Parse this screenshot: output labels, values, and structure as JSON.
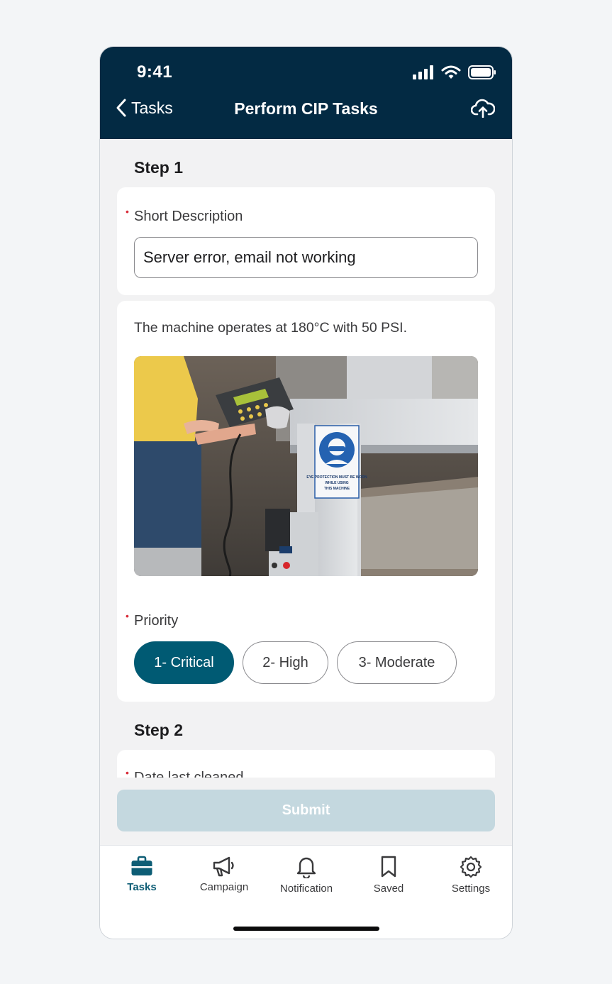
{
  "status": {
    "time": "9:41"
  },
  "nav": {
    "back_label": "Tasks",
    "title": "Perform CIP Tasks"
  },
  "step1": {
    "heading": "Step 1",
    "short_description_label": "Short Description",
    "short_description_value": "Server error, email not working",
    "description_text": "The machine operates at 180°C with 50 PSI.",
    "image_sign_text": "EYE PROTECTION MUST BE WORN WHILE USING THIS MACHINE",
    "priority_label": "Priority",
    "priority_options": [
      "1- Critical",
      "2- High",
      "3- Moderate"
    ],
    "priority_selected": "1- Critical"
  },
  "step2": {
    "heading": "Step 2",
    "date_label": "Date last cleaned"
  },
  "submit_label": "Submit",
  "tabs": [
    {
      "label": "Tasks",
      "icon": "briefcase-icon",
      "active": true
    },
    {
      "label": "Campaign",
      "icon": "megaphone-icon",
      "active": false
    },
    {
      "label": "Notification",
      "icon": "bell-icon",
      "active": false
    },
    {
      "label": "Saved",
      "icon": "bookmark-icon",
      "active": false
    },
    {
      "label": "Settings",
      "icon": "gear-icon",
      "active": false
    }
  ],
  "colors": {
    "header": "#032a43",
    "accent": "#005a73",
    "required": "#d92d3a",
    "submit_disabled": "#c4d8df",
    "active_tab": "#0d5d75"
  }
}
